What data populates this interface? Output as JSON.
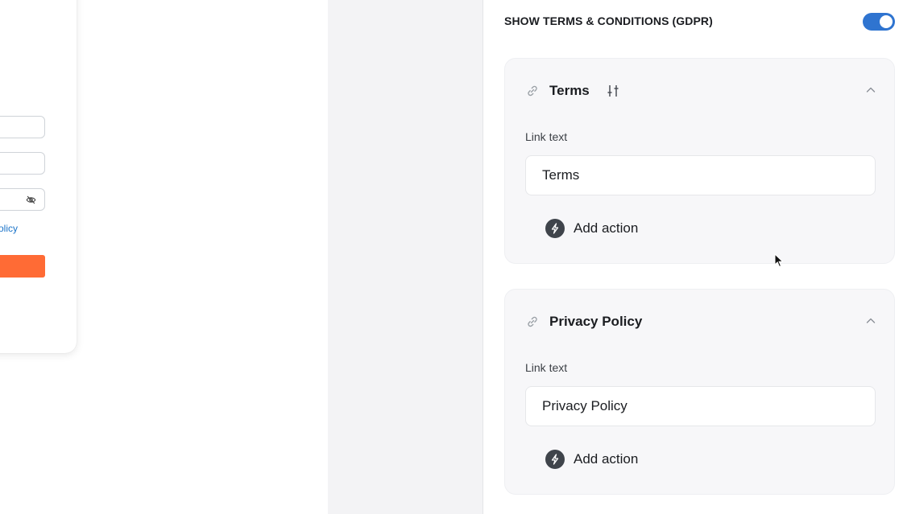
{
  "preview": {
    "link_text": "Policy"
  },
  "settings": {
    "toggle_label": "SHOW TERMS & CONDITIONS (GDPR)",
    "toggle_on": true,
    "sections": [
      {
        "title": "Terms",
        "field_label": "Link text",
        "field_value": "Terms",
        "action_label": "Add action"
      },
      {
        "title": "Privacy Policy",
        "field_label": "Link text",
        "field_value": "Privacy Policy",
        "action_label": "Add action"
      }
    ]
  },
  "colors": {
    "accent": "#2f74d0",
    "preview_button": "#ff6b35",
    "preview_link": "#1a73c8"
  }
}
